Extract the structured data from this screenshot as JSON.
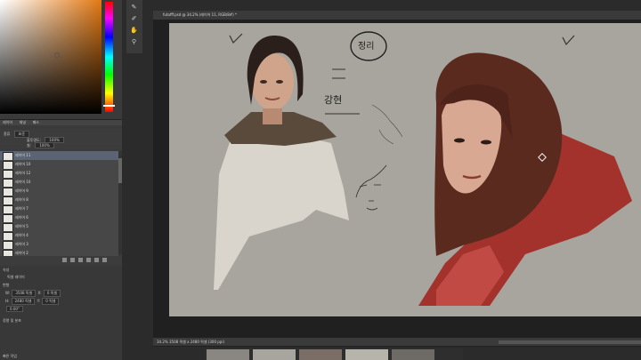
{
  "window": {
    "document_title": "futofff.psd @ 34.2% (레이어 11, RGB/8#) *"
  },
  "color_picker": {
    "hue_color": "#e27914",
    "tabs": [
      "레이어",
      "채널",
      "패스"
    ]
  },
  "layer_options": {
    "blend_label": "종류",
    "blend_value": "표준",
    "opacity_label": "불투명도:",
    "opacity_value": "100%",
    "fill_label": "칠:",
    "fill_value": "100%"
  },
  "layers": [
    {
      "name": "레이어 11",
      "selected": true
    },
    {
      "name": "레이어 10",
      "selected": false
    },
    {
      "name": "레이어 12",
      "selected": false
    },
    {
      "name": "레이어 10",
      "selected": false
    },
    {
      "name": "레이어 9",
      "selected": false
    },
    {
      "name": "레이어 8",
      "selected": false
    },
    {
      "name": "레이어 7",
      "selected": false
    },
    {
      "name": "레이어 6",
      "selected": false
    },
    {
      "name": "레이어 5",
      "selected": false
    },
    {
      "name": "레이어 4",
      "selected": false
    },
    {
      "name": "레이어 3",
      "selected": false
    },
    {
      "name": "레이어 2",
      "selected": false
    }
  ],
  "properties": {
    "tabs": [
      "속성"
    ],
    "section_label": "픽셀 레이어",
    "transform_label": "변형",
    "w_label": "W:",
    "w_value": "3508 픽셀",
    "x_label": "X:",
    "x_value": "0 픽셀",
    "h_label": "H:",
    "h_value": "2480 픽셀",
    "y_label": "Y:",
    "y_value": "0 픽셀",
    "angle_value": "0.00°",
    "align_label": "정렬 및 분포",
    "quick_actions_label": "빠른 작업"
  },
  "canvas": {
    "handwriting_1": "정리",
    "handwriting_2": "강현",
    "background_color": "#a7a59d"
  },
  "status": {
    "zoom": "34.2%",
    "doc_size": "3508 픽셀 x 2480 픽셀 (300 ppi)"
  },
  "icons": [
    "brush-icon",
    "eraser-icon",
    "hand-icon",
    "zoom-icon",
    "gear-icon",
    "trash-icon",
    "link-icon",
    "fx-icon",
    "mask-icon",
    "folder-icon",
    "new-layer-icon"
  ]
}
